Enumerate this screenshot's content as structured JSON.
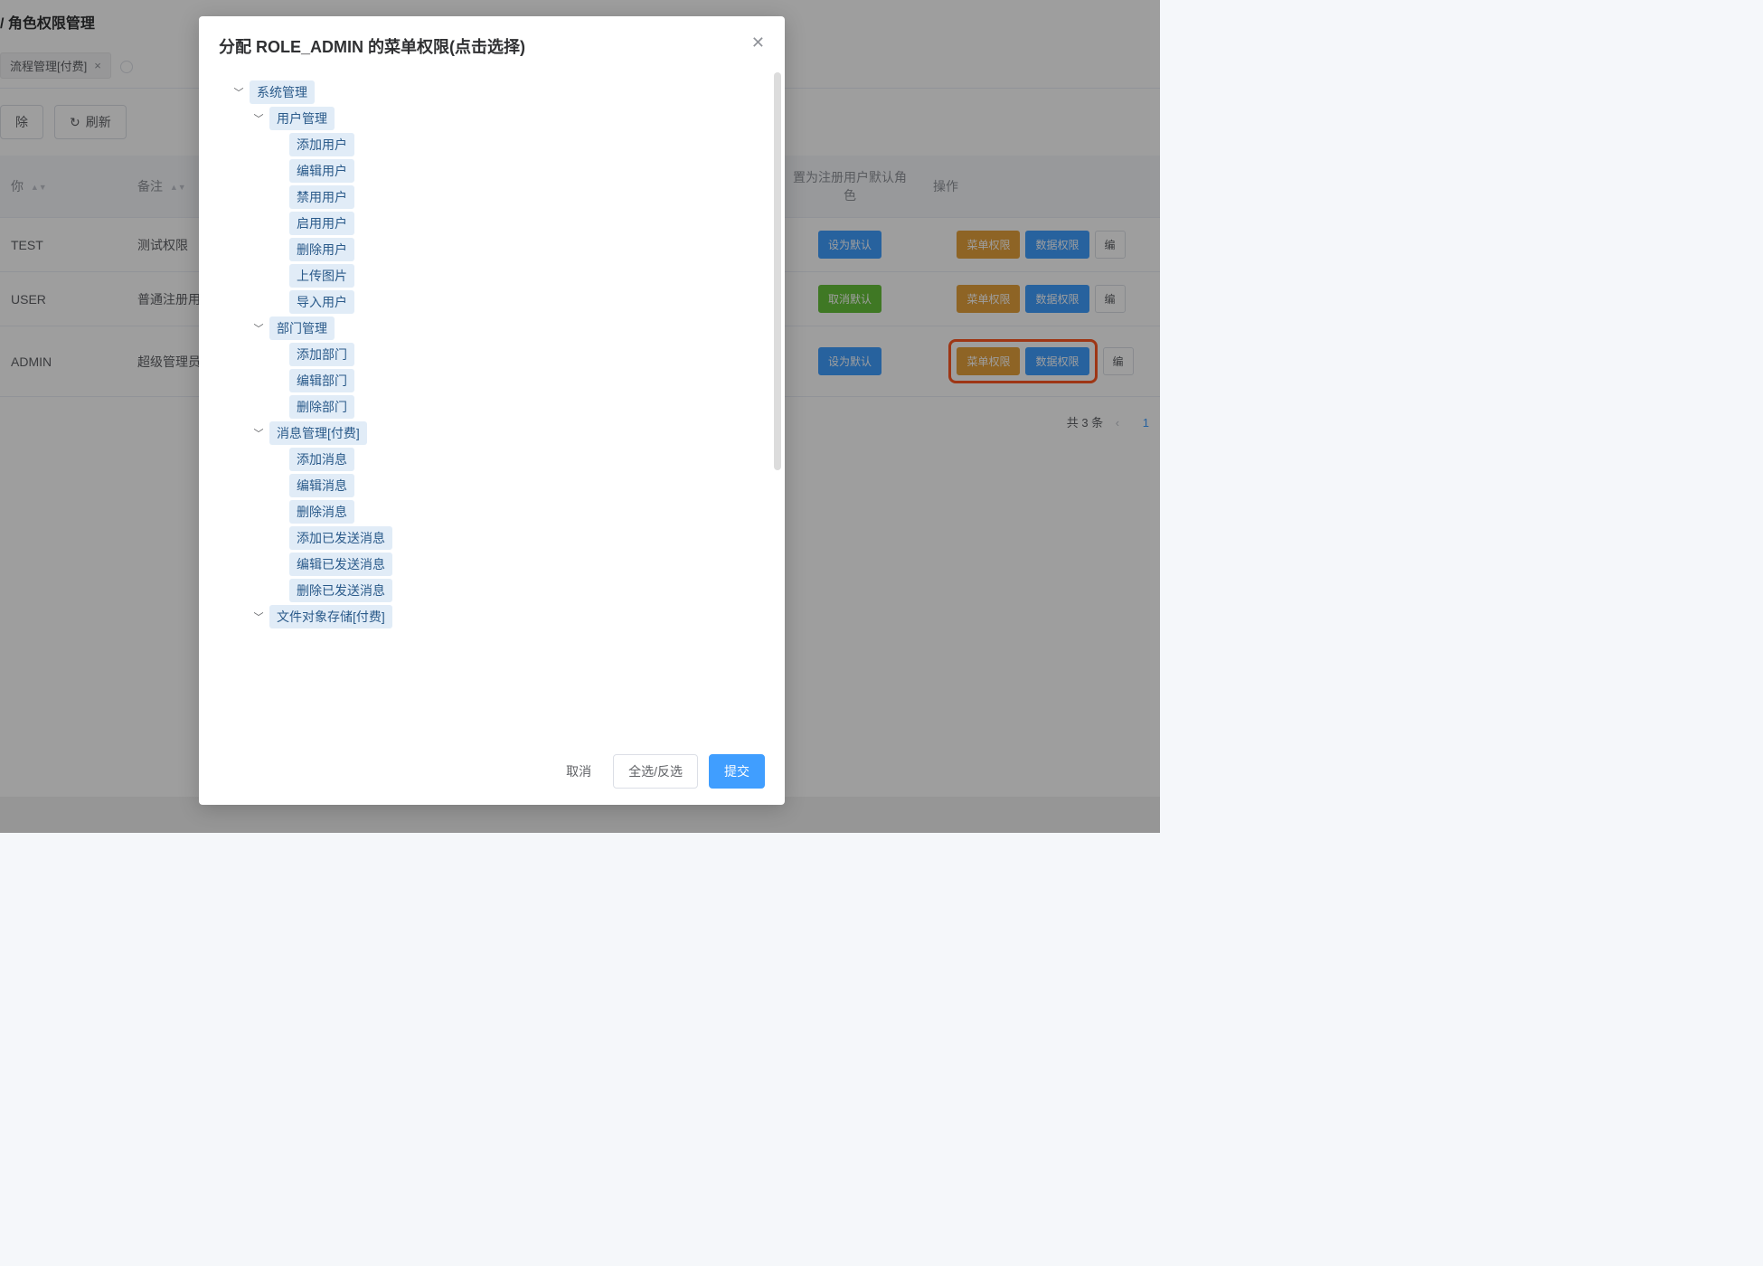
{
  "breadcrumb": {
    "sep": "/",
    "current": "角色权限管理"
  },
  "filter": {
    "tag_label": "流程管理[付费]",
    "close": "×"
  },
  "toolbar": {
    "delete_suffix": "除",
    "refresh_icon": "↻",
    "refresh": "刷新"
  },
  "table": {
    "col_name": "你",
    "col_remark": "备注",
    "col_default_header": "置为注册用户默认角色",
    "col_actions": "操作",
    "rows": [
      {
        "name": "TEST",
        "remark": "测试权限",
        "default_btn": "设为默认",
        "default_style": "info",
        "menu_perm": "菜单权限",
        "data_perm": "数据权限",
        "edit": "编",
        "highlight": false
      },
      {
        "name": "USER",
        "remark": "普通注册用",
        "default_btn": "取消默认",
        "default_style": "success",
        "menu_perm": "菜单权限",
        "data_perm": "数据权限",
        "edit": "编",
        "highlight": false
      },
      {
        "name": "ADMIN",
        "remark": "超级管理员",
        "default_btn": "设为默认",
        "default_style": "info",
        "menu_perm": "菜单权限",
        "data_perm": "数据权限",
        "edit": "编",
        "highlight": true
      }
    ]
  },
  "pagination": {
    "total": "共 3 条",
    "page": "1"
  },
  "modal": {
    "title": "分配 ROLE_ADMIN 的菜单权限(点击选择)",
    "footer": {
      "cancel": "取消",
      "select_all": "全选/反选",
      "submit": "提交"
    },
    "tree": [
      {
        "label": "系统管理",
        "children": [
          {
            "label": "用户管理",
            "children": [
              {
                "label": "添加用户"
              },
              {
                "label": "编辑用户"
              },
              {
                "label": "禁用用户"
              },
              {
                "label": "启用用户"
              },
              {
                "label": "删除用户"
              },
              {
                "label": "上传图片"
              },
              {
                "label": "导入用户"
              }
            ]
          },
          {
            "label": "部门管理",
            "children": [
              {
                "label": "添加部门"
              },
              {
                "label": "编辑部门"
              },
              {
                "label": "删除部门"
              }
            ]
          },
          {
            "label": "消息管理[付费]",
            "children": [
              {
                "label": "添加消息"
              },
              {
                "label": "编辑消息"
              },
              {
                "label": "删除消息"
              },
              {
                "label": "添加已发送消息"
              },
              {
                "label": "编辑已发送消息"
              },
              {
                "label": "删除已发送消息"
              }
            ]
          },
          {
            "label": "文件对象存储[付费]",
            "children": []
          }
        ]
      }
    ]
  }
}
